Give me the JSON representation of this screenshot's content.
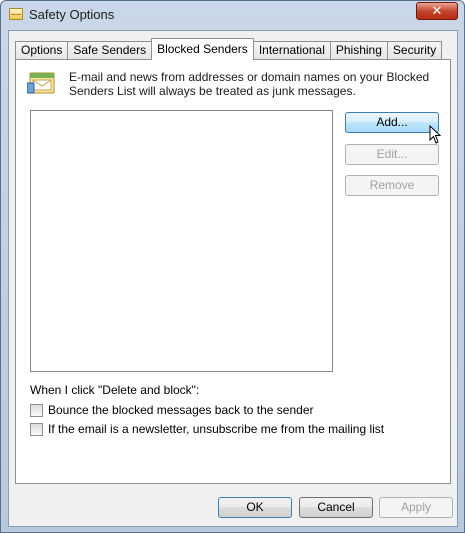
{
  "window": {
    "title": "Safety Options",
    "close_glyph": "✕"
  },
  "tabs": [
    {
      "label": "Options",
      "active": false
    },
    {
      "label": "Safe Senders",
      "active": false
    },
    {
      "label": "Blocked Senders",
      "active": true
    },
    {
      "label": "International",
      "active": false
    },
    {
      "label": "Phishing",
      "active": false
    },
    {
      "label": "Security",
      "active": false
    }
  ],
  "panel": {
    "info_icon": "mail-envelope-icon",
    "info_text": "E-mail and news from addresses or domain names on your Blocked Senders List will always be treated as junk messages.",
    "list_items": [],
    "buttons": {
      "add": "Add...",
      "edit": "Edit...",
      "remove": "Remove"
    },
    "when_label": "When I click \"Delete and block\":",
    "checkboxes": [
      {
        "label": "Bounce the blocked messages back to the sender",
        "checked": false
      },
      {
        "label": "If the email is a newsletter, unsubscribe me from the mailing list",
        "checked": false
      }
    ]
  },
  "footer": {
    "ok": "OK",
    "cancel": "Cancel",
    "apply": "Apply"
  },
  "colors": {
    "frame": "#c9d7e8",
    "close_button": "#c5462f",
    "hot_button": "#bee6fd"
  }
}
